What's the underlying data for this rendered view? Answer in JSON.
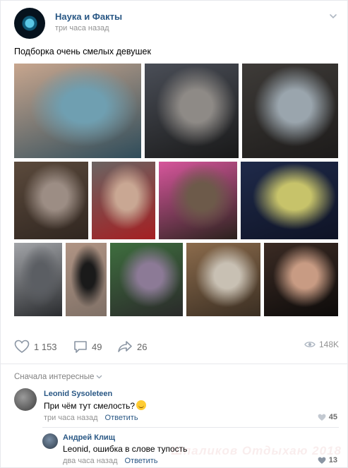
{
  "post": {
    "channel_name": "Наука и Факты",
    "time": "три часа назад",
    "text": "Подборка очень смелых девушек",
    "photos": [
      {
        "name": "photo-fish-market",
        "colors": [
          "#c8a68e",
          "#6f9fb1",
          "#2f4c5a"
        ]
      },
      {
        "name": "photo-subway-seat",
        "colors": [
          "#4a4e57",
          "#8e8a86",
          "#191919"
        ]
      },
      {
        "name": "photo-airplane-window",
        "colors": [
          "#3e3b38",
          "#9aa5ad",
          "#1d1b1a"
        ]
      },
      {
        "name": "photo-street-sitting",
        "colors": [
          "#5b4a3c",
          "#9c8d84",
          "#302620"
        ]
      },
      {
        "name": "photo-red-sandals",
        "colors": [
          "#6b6462",
          "#c9a793",
          "#a51f22"
        ]
      },
      {
        "name": "photo-pink-bag",
        "colors": [
          "#d7569c",
          "#6d5a4a",
          "#2b221d"
        ]
      },
      {
        "name": "photo-theater-seats",
        "colors": [
          "#1f2a4a",
          "#c7c36a",
          "#0e1325"
        ]
      },
      {
        "name": "photo-city-street",
        "colors": [
          "#a2a4a8",
          "#5b5e63",
          "#2a2c2f"
        ]
      },
      {
        "name": "photo-mesh-outfit",
        "colors": [
          "#b09484",
          "#1a1a1a",
          "#7f7066"
        ]
      },
      {
        "name": "photo-green-bin",
        "colors": [
          "#3e6e3e",
          "#8c7a96",
          "#2a2a2a"
        ]
      },
      {
        "name": "photo-window-sill",
        "colors": [
          "#8b6b4c",
          "#c8c0b3",
          "#3a2e22"
        ]
      },
      {
        "name": "photo-night-walk",
        "colors": [
          "#3b2b24",
          "#c89b83",
          "#0d0b0a"
        ]
      }
    ],
    "likes": "1 153",
    "comments": "49",
    "shares": "26",
    "views": "148K"
  },
  "comments": {
    "sort_label": "Сначала интересные",
    "items": [
      {
        "author": "Leonid Sysoleteen",
        "text": "При чём тут смелость?",
        "time": "три часа назад",
        "reply_label": "Ответить",
        "likes": "45"
      },
      {
        "author": "Андрей Клищ",
        "text": "Leonid, ошибка в слове тупость",
        "time": "два часа назад",
        "reply_label": "Ответить",
        "likes": "13"
      }
    ]
  },
  "colors": {
    "link": "#2a5885",
    "meta": "#939393",
    "divider": "#e7e8ec"
  },
  "watermark": "Шпаликов Отдыхаю 2018"
}
